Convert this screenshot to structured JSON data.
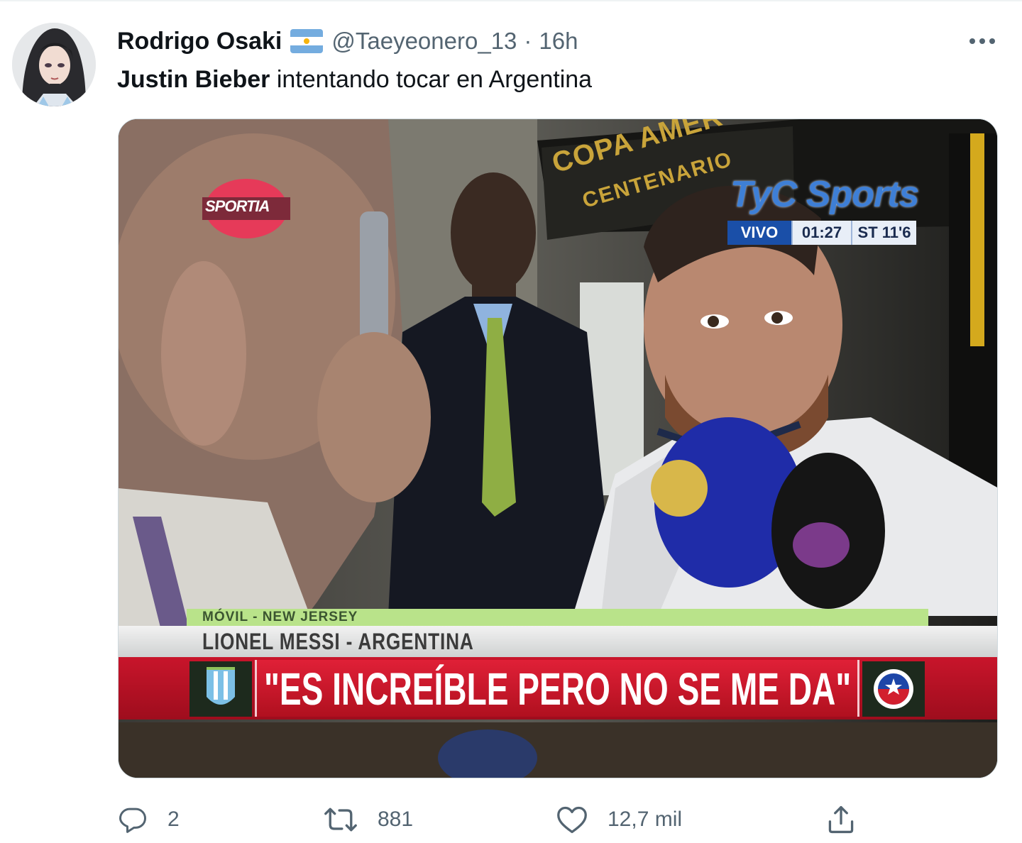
{
  "tweet": {
    "author": {
      "display_name": "Rodrigo Osaki",
      "flag_icon": "argentina-flag-icon",
      "handle": "@Taeyeonero_13",
      "separator": "·",
      "time": "16h"
    },
    "text": {
      "bold_part": "Justin Bieber",
      "rest": " intentando tocar en Argentina"
    },
    "media": {
      "overlay": {
        "channel_logo": "TyC Sports",
        "live_label": "VIVO",
        "clock": "01:27",
        "period": "ST 11'6",
        "corner_logo": "SPORTIA",
        "background_sign_line1": "COPA AMER",
        "background_sign_line2": "CENTENARIO",
        "location": "MÓVIL - NEW JERSEY",
        "player": "LIONEL MESSI - ARGENTINA",
        "quote": "\"ES INCREÍBLE PERO NO SE ME DA\""
      }
    },
    "actions": {
      "reply_count": "2",
      "retweet_count": "881",
      "like_count": "12,7 mil"
    }
  },
  "colors": {
    "text": "#0f1419",
    "secondary": "#536471",
    "banner_red": "#c8152b",
    "banner_green": "#b9e38a",
    "tyc_blue": "#3e7fd6"
  }
}
